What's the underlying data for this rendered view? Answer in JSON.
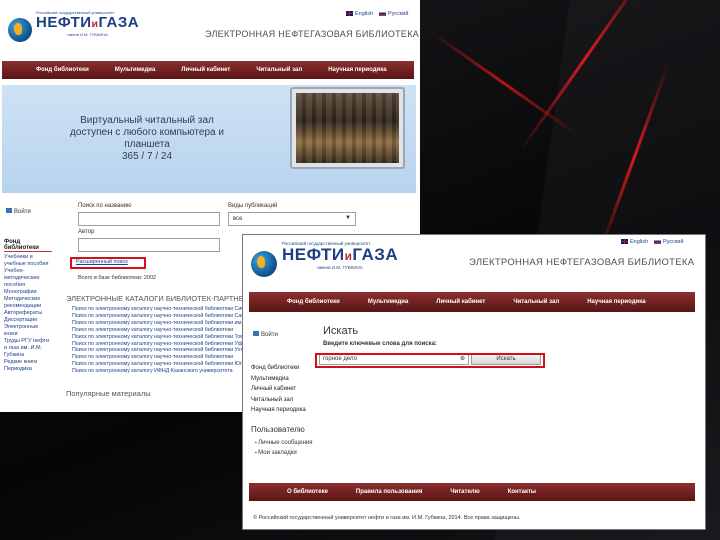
{
  "site": {
    "uni_lines": [
      "Российский государственный университет",
      "нефти и газа",
      "имени И.М. ГУБКИНА"
    ],
    "logo_word_1": "НЕФТИ",
    "logo_and": "и",
    "logo_word_2": "ГАЗА",
    "library_title": "ЭЛЕКТРОННАЯ НЕФТЕГАЗОВАЯ БИБЛИОТЕКА",
    "lang_en": "English",
    "lang_ru": "Русский"
  },
  "back_window": {
    "nav": [
      "Фонд библиотеки",
      "Мультимедиа",
      "Личный кабинет",
      "Читальный зал",
      "Научная периодика"
    ],
    "banner": {
      "line1": "Виртуальный читальный зал",
      "line2": "доступен с любого компьютера и планшета",
      "line3": "365 / 7 / 24"
    },
    "login_label": "Войти",
    "sidebar_heading": "Фонд библиотеки",
    "sidebar_items": [
      "Учебники и учебные пособия",
      "Учебно-методические пособия",
      "Монографии",
      "Методические рекомендации",
      "Авторефераты",
      "Диссертации",
      "Электронные книги",
      "Труды РГУ нефти и газа им. И.М. Губкина",
      "Редкие книги",
      "Периодика"
    ],
    "search": {
      "title_label": "Поиск по названию",
      "author_label": "Автор",
      "types_label": "Виды публикаций",
      "types_value": "все",
      "advanced_link": "Расширенный поиск",
      "total_text": "Всего в базе библиотеки: 2002"
    },
    "catalogs_heading": "ЭЛЕКТРОННЫЕ КАТАЛОГИ БИБЛИОТЕК-ПАРТНЕРОВ",
    "catalog_links": [
      "Поиск по электронному каталогу научно-технической библиотеки Сибирского федерального университета",
      "Поиск по электронному каталогу научно-технической библиотеки Самарского университета",
      "Поиск по электронному каталогу научно-технической библиотеки им. Н.Г. Чернышевского",
      "Поиск по электронному каталогу научно-технической библиотеки",
      "Поиск по электронному каталогу научно-технической библиотеки Томского университета",
      "Поиск по электронному каталогу научно-технической библиотеки Уфимского университета",
      "Поиск по электронному каталогу научно-технической библиотеки Ухтинского университета",
      "Поиск по электронному каталогу научно-технической библиотеки",
      "Поиск по электронному каталогу научно-технической библиотеки Югорского университета",
      "Поиск по электронному каталогу ИФНД Казанского университета"
    ],
    "popular_heading": "Популярные материалы"
  },
  "front_window": {
    "nav": [
      "Фонд библиотеки",
      "Мультимедиа",
      "Личный кабинет",
      "Читальный зал",
      "Научная периодика"
    ],
    "login_label": "Войти",
    "sidebar_items": [
      "Фонд библиотеки",
      "Мультимедиа",
      "Личный кабинет",
      "Читальный зал",
      "Научная периодика"
    ],
    "search": {
      "heading": "Искать",
      "prompt": "Введите ключевые слова для поиска:",
      "query": "горное дело",
      "button": "Искать"
    },
    "user_block": {
      "heading": "Пользователю",
      "links": [
        "Личные сообщения",
        "Мои закладки"
      ]
    },
    "footer_nav": [
      "О библиотеке",
      "Правила пользования",
      "Читателю",
      "Контакты"
    ],
    "copyright": "© Российский государственный университет нефти и газа им. И.М. Губкина, 2014. Все права защищены."
  },
  "colors": {
    "nav_red": "#7a2323",
    "link_blue": "#1a3f8f",
    "highlight_red": "#d40f1c"
  }
}
